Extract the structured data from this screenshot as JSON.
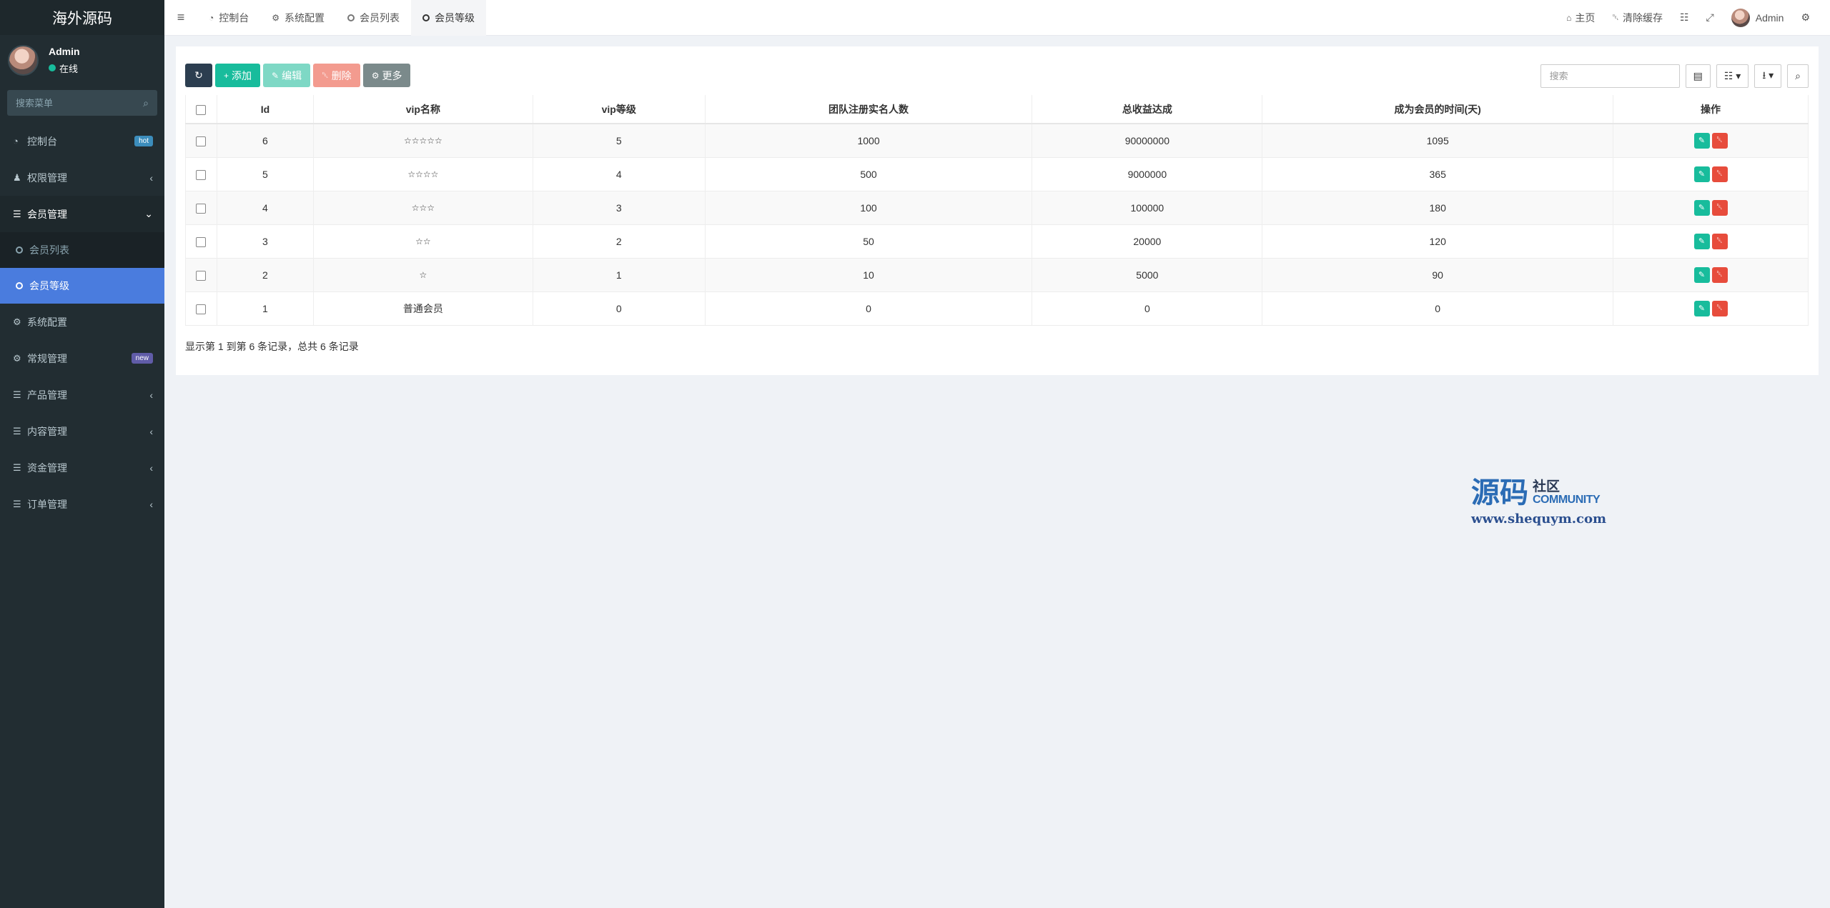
{
  "app": {
    "logo": "海外源码",
    "user": {
      "name": "Admin",
      "status": "在线"
    },
    "search_placeholder": "搜索菜单"
  },
  "sidebar": {
    "items": [
      {
        "label": "控制台",
        "icon": "dashboard-icon",
        "badge": "hot"
      },
      {
        "label": "权限管理",
        "icon": "users-icon"
      },
      {
        "label": "会员管理",
        "icon": "list-icon",
        "open": true
      },
      {
        "label": "系统配置",
        "icon": "gear-icon"
      },
      {
        "label": "常规管理",
        "icon": "cogs-icon",
        "badge": "new"
      },
      {
        "label": "产品管理",
        "icon": "list-icon"
      },
      {
        "label": "内容管理",
        "icon": "list-icon"
      },
      {
        "label": "资金管理",
        "icon": "list-icon"
      },
      {
        "label": "订单管理",
        "icon": "list-icon"
      }
    ],
    "subitems": [
      {
        "label": "会员列表"
      },
      {
        "label": "会员等级",
        "active": true
      }
    ]
  },
  "header": {
    "tabs": [
      {
        "label": "控制台"
      },
      {
        "label": "系统配置"
      },
      {
        "label": "会员列表"
      },
      {
        "label": "会员等级",
        "active": true
      }
    ],
    "right": {
      "home": "主页",
      "clear_cache": "清除缓存",
      "user": "Admin"
    }
  },
  "toolbar": {
    "add": "添加",
    "edit": "编辑",
    "delete": "删除",
    "more": "更多",
    "search_placeholder": "搜索"
  },
  "table": {
    "headers": [
      "Id",
      "vip名称",
      "vip等级",
      "团队注册实名人数",
      "总收益达成",
      "成为会员的时间(天)",
      "操作"
    ],
    "rows": [
      {
        "id": "6",
        "name": "☆☆☆☆☆",
        "level": "5",
        "team": "1000",
        "income": "90000000",
        "days": "1095"
      },
      {
        "id": "5",
        "name": "☆☆☆☆",
        "level": "4",
        "team": "500",
        "income": "9000000",
        "days": "365"
      },
      {
        "id": "4",
        "name": "☆☆☆",
        "level": "3",
        "team": "100",
        "income": "100000",
        "days": "180"
      },
      {
        "id": "3",
        "name": "☆☆",
        "level": "2",
        "team": "50",
        "income": "20000",
        "days": "120"
      },
      {
        "id": "2",
        "name": "☆",
        "level": "1",
        "team": "10",
        "income": "5000",
        "days": "90"
      },
      {
        "id": "1",
        "name": "普通会员",
        "level": "0",
        "team": "0",
        "income": "0",
        "days": "0"
      }
    ]
  },
  "pager": {
    "summary": "显示第 1 到第 6 条记录，总共 6 条记录"
  },
  "watermark": {
    "big": "源码",
    "cn": "社区",
    "en": "COMMUNITY",
    "url": "www.shequym.com"
  },
  "colors": {
    "sidebar_bg": "#222d32",
    "active": "#4a7cde",
    "success": "#18bc9c",
    "danger": "#e74c3c"
  }
}
